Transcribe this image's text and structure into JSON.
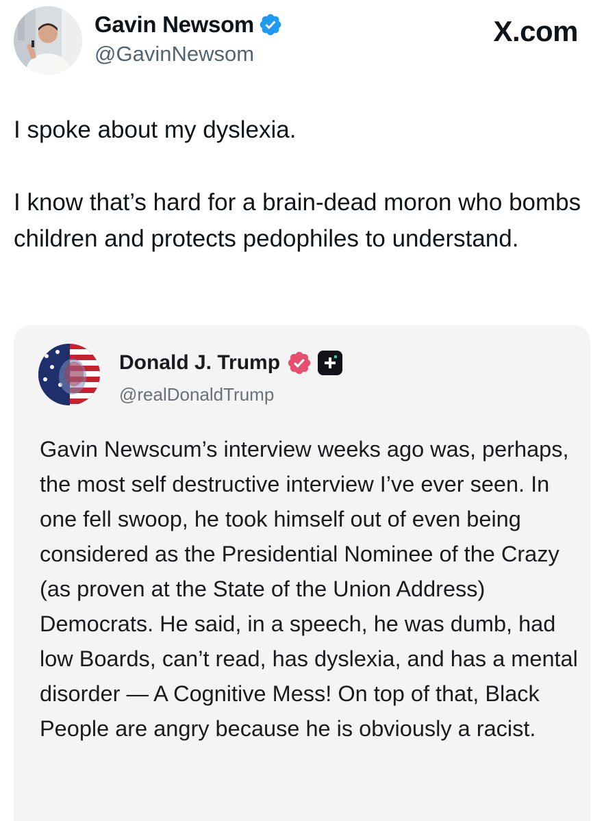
{
  "site_label": "X.com",
  "post": {
    "author_name": "Gavin Newsom",
    "author_handle": "@GavinNewsom",
    "text_paragraphs": [
      "I spoke about my dyslexia.",
      "I know that’s hard for a brain-dead moron who bombs children and protects pedophiles to understand."
    ]
  },
  "quoted_post": {
    "author_name": "Donald J. Trump",
    "author_handle": "@realDonaldTrump",
    "text": "Gavin Newscum’s interview weeks ago was, perhaps, the most self destructive interview I’ve ever seen. In one fell swoop, he took himself out of even being considered as the Presidential Nominee of the Crazy (as proven at the State of the Union Address) Democrats. He said, in a speech, he was dumb, had low Boards, can’t read, has dyslexia, and has a mental disorder — A Cognitive Mess! On top of that, Black People are angry because he is obviously a racist."
  },
  "colors": {
    "text_primary": "#0f1419",
    "text_secondary": "#536471",
    "verified_blue": "#1d9bf0",
    "truth_badge": "#e84f6f",
    "quote_background": "#f4f4f5"
  },
  "icons": {
    "author_badge": "verified-checkmark-icon",
    "quoted_badge": "verified-badge-icon",
    "quoted_extra": "plus-icon"
  }
}
